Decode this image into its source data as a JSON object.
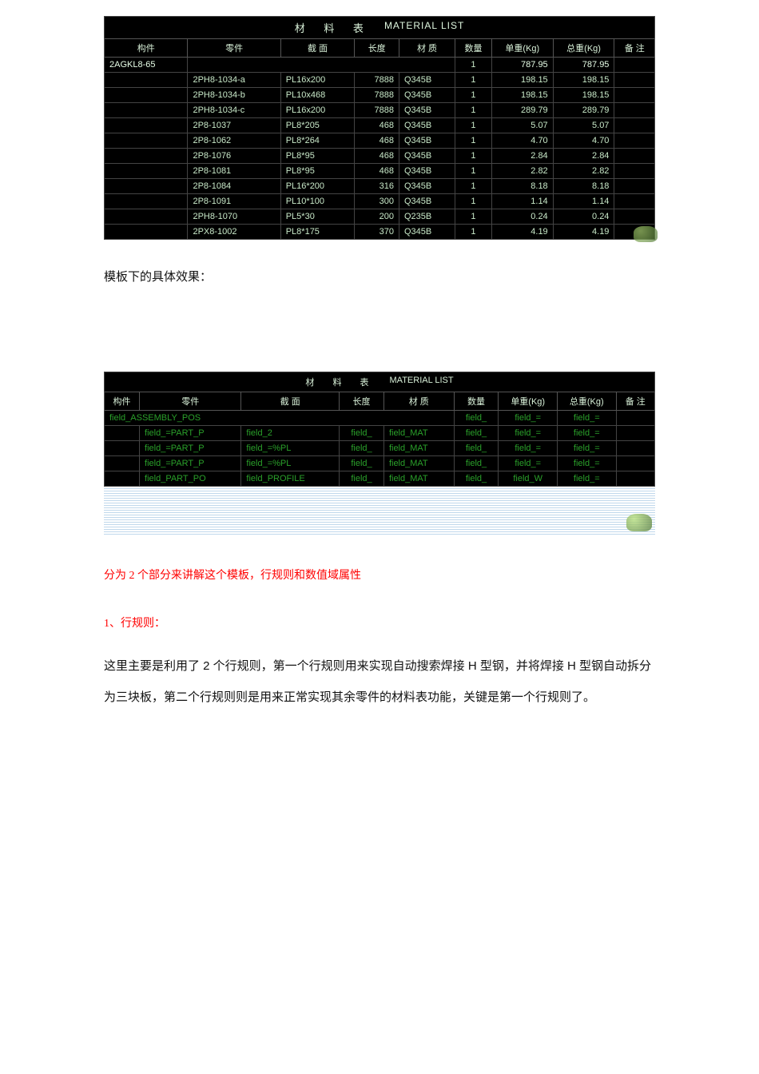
{
  "table1": {
    "title_cn": "材 料 表",
    "title_en": "MATERIAL LIST",
    "headers": [
      "构件",
      "零件",
      "截  面",
      "长度",
      "材 质",
      "数量",
      "单重(Kg)",
      "总重(Kg)",
      "备 注"
    ],
    "assembly_row": {
      "c0": "2AGKL8-65",
      "qty": "1",
      "unit": "787.95",
      "total": "787.95"
    },
    "rows": [
      {
        "part": "2PH8-1034-a",
        "profile": "PL16x200",
        "len": "7888",
        "mat": "Q345B",
        "qty": "1",
        "unit": "198.15",
        "total": "198.15"
      },
      {
        "part": "2PH8-1034-b",
        "profile": "PL10x468",
        "len": "7888",
        "mat": "Q345B",
        "qty": "1",
        "unit": "198.15",
        "total": "198.15"
      },
      {
        "part": "2PH8-1034-c",
        "profile": "PL16x200",
        "len": "7888",
        "mat": "Q345B",
        "qty": "1",
        "unit": "289.79",
        "total": "289.79"
      },
      {
        "part": "2P8-1037",
        "profile": "PL8*205",
        "len": "468",
        "mat": "Q345B",
        "qty": "1",
        "unit": "5.07",
        "total": "5.07"
      },
      {
        "part": "2P8-1062",
        "profile": "PL8*264",
        "len": "468",
        "mat": "Q345B",
        "qty": "1",
        "unit": "4.70",
        "total": "4.70"
      },
      {
        "part": "2P8-1076",
        "profile": "PL8*95",
        "len": "468",
        "mat": "Q345B",
        "qty": "1",
        "unit": "2.84",
        "total": "2.84"
      },
      {
        "part": "2P8-1081",
        "profile": "PL8*95",
        "len": "468",
        "mat": "Q345B",
        "qty": "1",
        "unit": "2.82",
        "total": "2.82"
      },
      {
        "part": "2P8-1084",
        "profile": "PL16*200",
        "len": "316",
        "mat": "Q345B",
        "qty": "1",
        "unit": "8.18",
        "total": "8.18"
      },
      {
        "part": "2P8-1091",
        "profile": "PL10*100",
        "len": "300",
        "mat": "Q345B",
        "qty": "1",
        "unit": "1.14",
        "total": "1.14"
      },
      {
        "part": "2PH8-1070",
        "profile": "PL5*30",
        "len": "200",
        "mat": "Q235B",
        "qty": "1",
        "unit": "0.24",
        "total": "0.24"
      },
      {
        "part": "2PX8-1002",
        "profile": "PL8*175",
        "len": "370",
        "mat": "Q345B",
        "qty": "1",
        "unit": "4.19",
        "total": "4.19"
      }
    ]
  },
  "text_template_effect": "模板下的具体效果：",
  "table2": {
    "title_cn": "材 料 表",
    "title_en": "MATERIAL LIST",
    "headers": [
      "构件",
      "零件",
      "截  面",
      "长度",
      "材 质",
      "数量",
      "单重(Kg)",
      "总重(Kg)",
      "备 注"
    ],
    "assembly_row": {
      "c0": "field_ASSEMBLY_POS",
      "qty": "field_",
      "unit": "field_=",
      "total": "field_="
    },
    "rows": [
      {
        "part": "field_=PART_P",
        "profile": "field_2",
        "len": "field_",
        "mat": "field_MAT",
        "qty": "field_",
        "unit": "field_=",
        "total": "field_="
      },
      {
        "part": "field_=PART_P",
        "profile": "field_=%PL",
        "len": "field_",
        "mat": "field_MAT",
        "qty": "field_",
        "unit": "field_=",
        "total": "field_="
      },
      {
        "part": "field_=PART_P",
        "profile": "field_=%PL",
        "len": "field_",
        "mat": "field_MAT",
        "qty": "field_",
        "unit": "field_=",
        "total": "field_="
      },
      {
        "part": "field_PART_PO",
        "profile": "field_PROFILE",
        "len": "field_",
        "mat": "field_MAT",
        "qty": "field_",
        "unit": "field_W",
        "total": "field_="
      }
    ]
  },
  "red1": "分为 2 个部分来讲解这个模板，行规则和数值域属性",
  "red2": "1、行规则：",
  "explain": "这里主要是利用了 2 个行规则，第一个行规则用来实现自动搜索焊接 H 型钢，并将焊接 H 型钢自动拆分为三块板，第二个行规则则是用来正常实现其余零件的材料表功能，关键是第一个行规则了。"
}
